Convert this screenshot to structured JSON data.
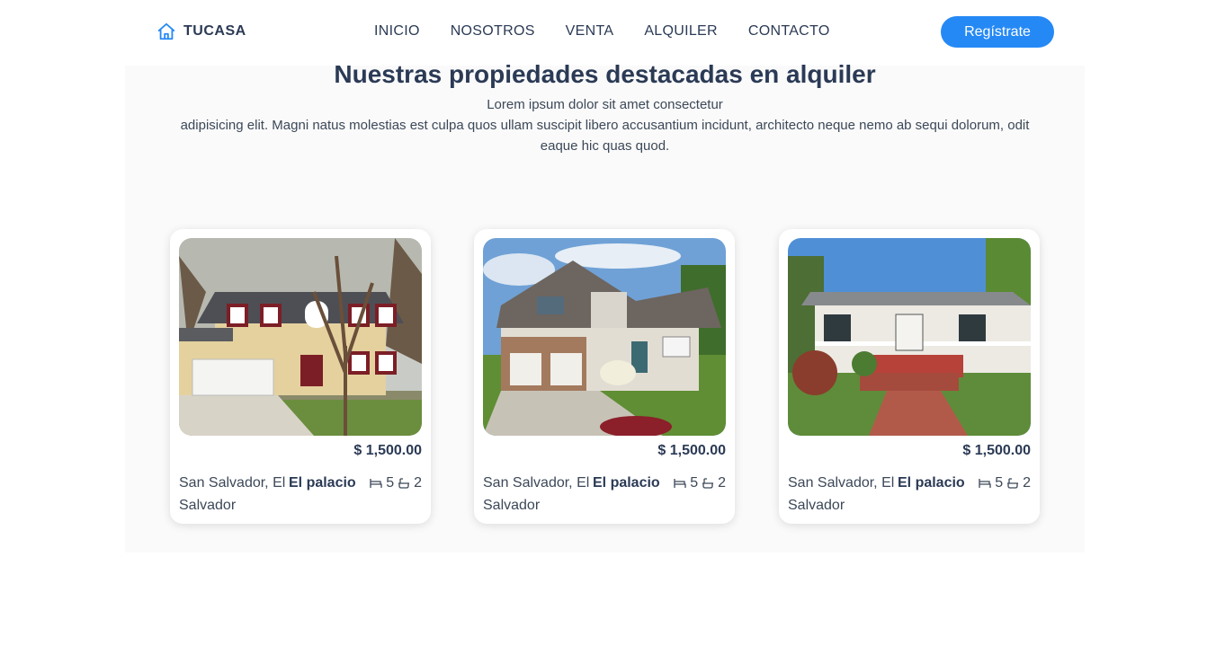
{
  "nav": {
    "brand": "TUCASA",
    "links": [
      "INICIO",
      "NOSOTROS",
      "VENTA",
      "ALQUILER",
      "CONTACTO"
    ],
    "cta_label": "Regístrate"
  },
  "section": {
    "title": "Nuestras propiedades destacadas en alquiler",
    "description_line1": "Lorem ipsum dolor sit amet consectetur",
    "description_line2": "adipisicing elit. Magni natus molestias est culpa quos ullam suscipit libero accusantium incidunt, architecto neque nemo ab sequi dolorum, odit eaque hic quas quod."
  },
  "properties": [
    {
      "price": "$ 1,500.00",
      "location": "San Salvador, El Salvador",
      "name": "El palacio",
      "beds": "5",
      "baths": "2"
    },
    {
      "price": "$ 1,500.00",
      "location": "San Salvador, El Salvador",
      "name": "El palacio",
      "beds": "5",
      "baths": "2"
    },
    {
      "price": "$ 1,500.00",
      "location": "San Salvador, El Salvador",
      "name": "El palacio",
      "beds": "5",
      "baths": "2"
    }
  ],
  "colors": {
    "accent": "#2589f5",
    "text": "#2b3a55",
    "section_bg": "#fafafa"
  }
}
